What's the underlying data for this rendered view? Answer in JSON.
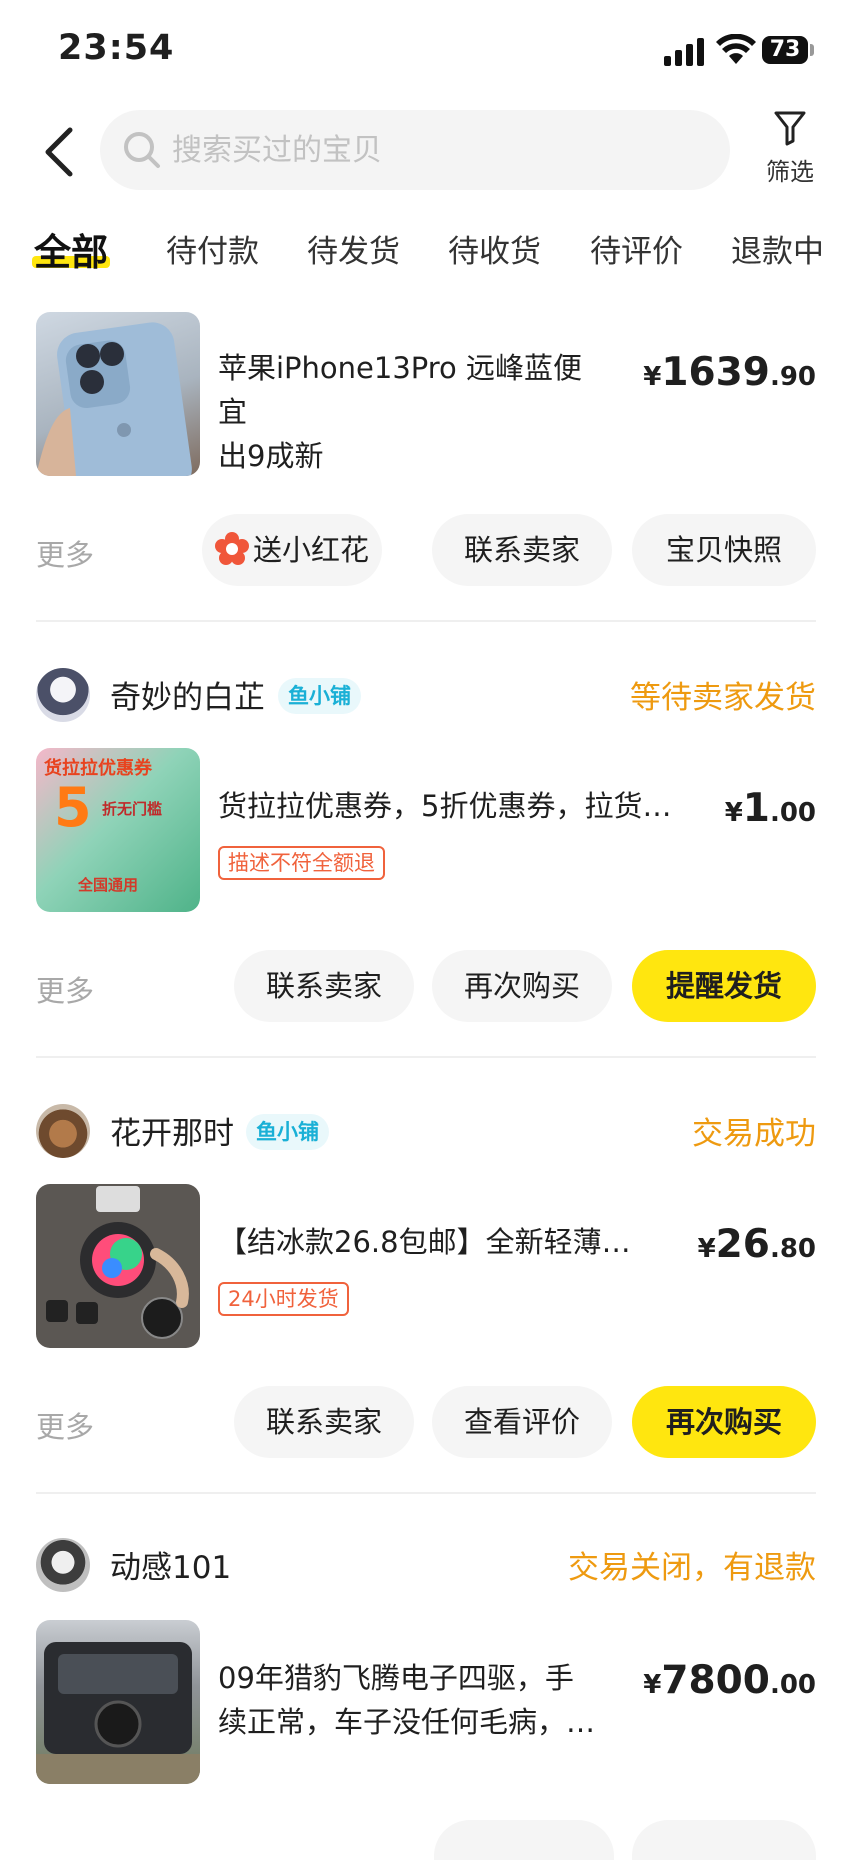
{
  "status_bar": {
    "time": "23:54",
    "battery": "73"
  },
  "header": {
    "search_placeholder": "搜索买过的宝贝",
    "filter_label": "筛选"
  },
  "tabs": [
    {
      "label": "全部",
      "active": true
    },
    {
      "label": "待付款"
    },
    {
      "label": "待发货"
    },
    {
      "label": "待收货"
    },
    {
      "label": "待评价"
    },
    {
      "label": "退款中"
    }
  ],
  "orders": [
    {
      "title_lines": [
        "苹果iPhone13Pro 远峰蓝便宜",
        "出9成新"
      ],
      "price": {
        "currency": "¥",
        "integer": "1639",
        "decimal": ".90"
      },
      "more": "更多",
      "actions": [
        "送小红花",
        "联系卖家",
        "宝贝快照"
      ]
    },
    {
      "shop": "奇妙的白芷",
      "shop_tag": "鱼小铺",
      "status": "等待卖家发货",
      "title_lines": [
        "货拉拉优惠券，5折优惠券，拉货…"
      ],
      "tag": "描述不符全额退",
      "thumb_texts": [
        "货拉拉优惠券",
        "5",
        "折无门槛",
        "全国通用"
      ],
      "price": {
        "currency": "¥",
        "integer": "1",
        "decimal": ".00"
      },
      "more": "更多",
      "actions": [
        "联系卖家",
        "再次购买",
        "提醒发货"
      ]
    },
    {
      "shop": "花开那时",
      "shop_tag": "鱼小铺",
      "status": "交易成功",
      "title_lines": [
        "【结冰款26.8包邮】全新轻薄…"
      ],
      "tag": "24小时发货",
      "price": {
        "currency": "¥",
        "integer": "26",
        "decimal": ".80"
      },
      "more": "更多",
      "actions": [
        "联系卖家",
        "查看评价",
        "再次购买"
      ]
    },
    {
      "shop": "动感101",
      "status": "交易关闭，有退款",
      "title_lines": [
        "09年猎豹飞腾电子四驱，手",
        "续正常，车子没任何毛病，…"
      ],
      "price": {
        "currency": "¥",
        "integer": "7800",
        "decimal": ".00"
      }
    }
  ],
  "colors": {
    "accent_yellow": "#ffe60f",
    "status_orange": "#ee9a10",
    "tag_red": "#f0623c",
    "shop_tag_blue": "#1ab0d6"
  }
}
